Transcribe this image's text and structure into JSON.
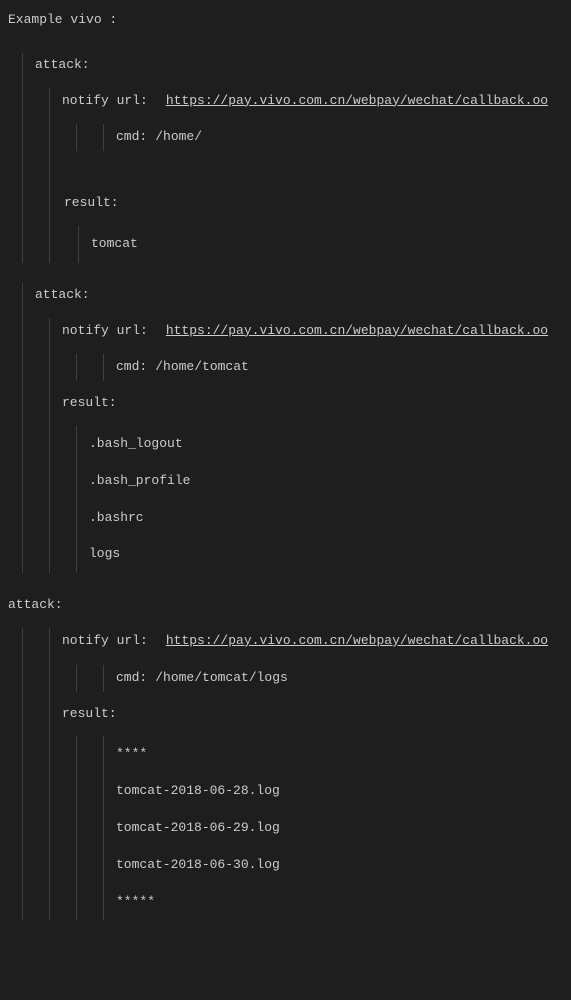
{
  "header": "Example  vivo :",
  "attacks": [
    {
      "label": "attack:",
      "notify_label": "notify url:",
      "notify_url": "https://pay.vivo.com.cn/webpay/wechat/callback.oo",
      "cmd_label": "cmd:",
      "cmd_value": "/home/",
      "result_label": "result:",
      "results": [
        "tomcat"
      ]
    },
    {
      "label": "attack:",
      "notify_label": "notify url:",
      "notify_url": "https://pay.vivo.com.cn/webpay/wechat/callback.oo",
      "cmd_label": "cmd:",
      "cmd_value": "/home/tomcat",
      "result_label": "result:",
      "results": [
        ".bash_logout",
        ".bash_profile",
        ".bashrc",
        "logs"
      ]
    },
    {
      "label": "attack:",
      "notify_label": "notify url:",
      "notify_url": "https://pay.vivo.com.cn/webpay/wechat/callback.oo",
      "cmd_label": "cmd:",
      "cmd_value": "/home/tomcat/logs",
      "result_label": "result:",
      "results": [
        "****",
        "tomcat-2018-06-28.log",
        "tomcat-2018-06-29.log",
        "tomcat-2018-06-30.log",
        "*****"
      ]
    }
  ]
}
